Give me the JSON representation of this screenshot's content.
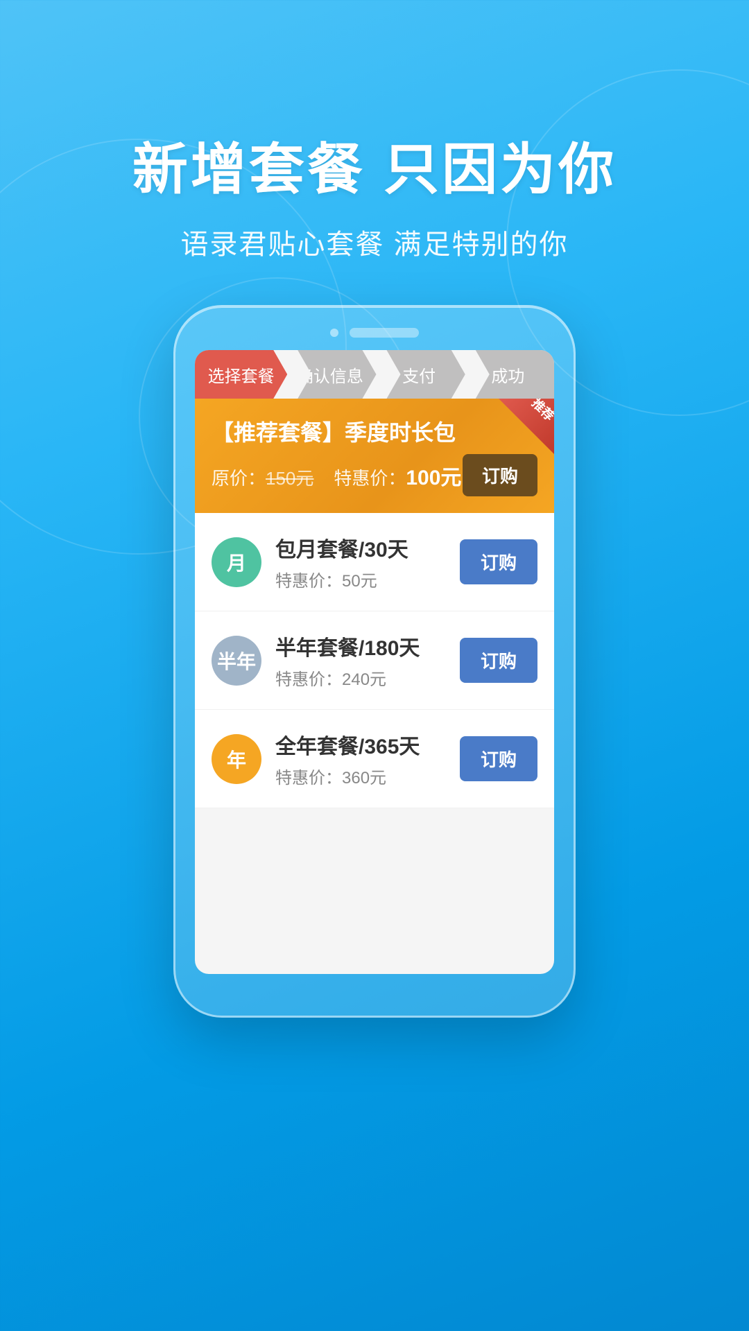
{
  "background": {
    "color": "#29b6f6"
  },
  "header": {
    "title": "新增套餐 只因为你",
    "subtitle": "语录君贴心套餐  满足特别的你"
  },
  "steps": [
    {
      "label": "选择套餐",
      "state": "active"
    },
    {
      "label": "确认信息",
      "state": "inactive"
    },
    {
      "label": "支付",
      "state": "inactive"
    },
    {
      "label": "成功",
      "state": "inactive"
    }
  ],
  "featured": {
    "corner_tag": "推荐",
    "title": "【推荐套餐】季度时长包",
    "original_price_label": "原价：",
    "original_price": "150元",
    "special_price_label": "特惠价：",
    "special_price": "100元",
    "buy_label": "订购"
  },
  "packages": [
    {
      "icon_label": "月",
      "icon_class": "icon-monthly",
      "name": "包月套餐/30天",
      "price": "特惠价：50元",
      "buy_label": "订购"
    },
    {
      "icon_label": "半年",
      "icon_class": "icon-halfyear",
      "name": "半年套餐/180天",
      "price": "特惠价：240元",
      "buy_label": "订购"
    },
    {
      "icon_label": "年",
      "icon_class": "icon-yearly",
      "name": "全年套餐/365天",
      "price": "特惠价：360元",
      "buy_label": "订购"
    }
  ]
}
